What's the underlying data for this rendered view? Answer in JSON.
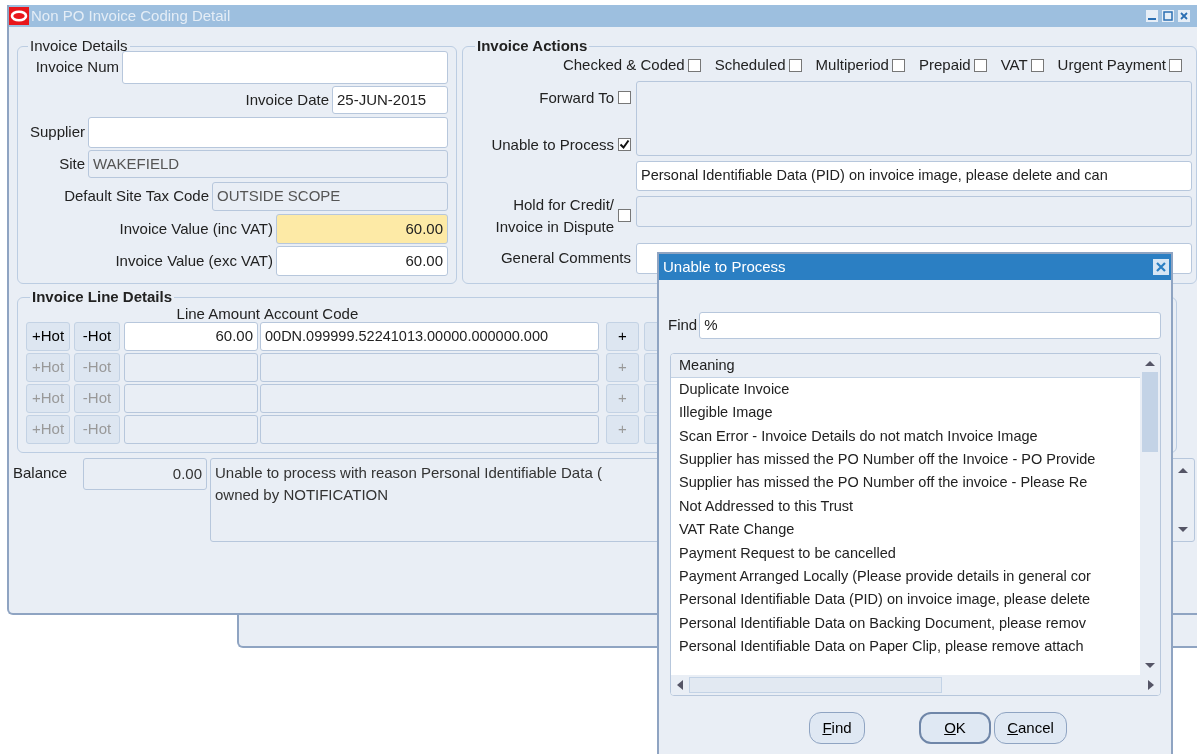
{
  "window": {
    "title": "Non PO Invoice Coding Detail"
  },
  "invoice_details": {
    "title": "Invoice Details",
    "fields": [
      {
        "label": "Invoice Num",
        "kind": "text"
      },
      {
        "label": "Invoice Date",
        "value": "25-JUN-2015",
        "kind": "text"
      },
      {
        "label": "Supplier",
        "kind": "text"
      },
      {
        "label": "Site",
        "value": "WAKEFIELD",
        "kind": "readonly"
      },
      {
        "label": "Default Site Tax Code",
        "value": "OUTSIDE SCOPE",
        "kind": "readonly"
      },
      {
        "label": "Invoice Value (inc VAT)",
        "value": "60.00",
        "kind": "required"
      },
      {
        "label": "Invoice Value (exc VAT)",
        "value": "60.00",
        "kind": "text"
      }
    ]
  },
  "invoice_actions": {
    "title": "Invoice Actions",
    "flags": [
      {
        "label": "Checked & Coded",
        "checked": false
      },
      {
        "label": "Scheduled",
        "checked": false
      },
      {
        "label": "Multiperiod",
        "checked": false
      },
      {
        "label": "Prepaid",
        "checked": false
      },
      {
        "label": "VAT",
        "checked": false
      },
      {
        "label": "Urgent Payment",
        "checked": false
      }
    ],
    "forward_to": {
      "label": "Forward To",
      "checked": false
    },
    "unable_to_process": {
      "label": "Unable to Process",
      "checked": true,
      "reason": "Personal Identifiable Data (PID) on invoice image, please delete and can"
    },
    "hold": {
      "label_lines": [
        "Hold for Credit/",
        "Invoice in Dispute"
      ],
      "checked": false
    },
    "general_comments": {
      "label": "General Comments"
    }
  },
  "line_details": {
    "title": "Invoice Line Details",
    "columns": [
      "Line Amount",
      "Account Code"
    ],
    "rows": [
      {
        "add_label": "+Hot",
        "remove_label": "-Hot",
        "amount": "60.00",
        "account": "00DN.099999.52241013.00000.000000.000",
        "plus": "+",
        "enabled": true
      },
      {
        "add_label": "+Hot",
        "remove_label": "-Hot",
        "plus": "+",
        "enabled": false
      },
      {
        "add_label": "+Hot",
        "remove_label": "-Hot",
        "plus": "+",
        "enabled": false
      },
      {
        "add_label": "+Hot",
        "remove_label": "-Hot",
        "plus": "+",
        "enabled": false
      }
    ]
  },
  "balance": {
    "label": "Balance",
    "value": "0.00",
    "message_lines": [
      "Unable to process with reason Personal Identifiable Data (",
      "owned by NOTIFICATION"
    ]
  },
  "dialog": {
    "title": "Unable to Process",
    "find_label": "Find",
    "find_value": "%",
    "column": "Meaning",
    "items": [
      {
        "text": "Duplicate Invoice",
        "selected": false
      },
      {
        "text": "Illegible Image",
        "selected": false
      },
      {
        "text": "Scan Error - Invoice Details do not match Invoice Image",
        "selected": false
      },
      {
        "text": "Supplier has missed the PO Number off the Invoice - PO Provide",
        "selected": false
      },
      {
        "text": "Supplier has missed the PO Number off the invoice  - Please Re",
        "selected": false
      },
      {
        "text": "Not Addressed to this Trust",
        "selected": false
      },
      {
        "text": "VAT Rate Change",
        "selected": false
      },
      {
        "text": "Payment Request to be cancelled",
        "selected": false
      },
      {
        "text": "Payment Arranged Locally (Please provide details in general cor",
        "selected": false
      },
      {
        "text": "Personal Identifiable Data (PID) on invoice image, please delete",
        "selected": false
      },
      {
        "text": "Personal Identifiable Data on Backing Document, please remov",
        "selected": false
      },
      {
        "text": "Personal Identifiable Data on Paper Clip, please remove attach",
        "selected": false
      }
    ],
    "buttons": [
      {
        "label": "Find",
        "default": false
      },
      {
        "label": "OK",
        "default": true
      },
      {
        "label": "Cancel",
        "default": false
      }
    ]
  }
}
